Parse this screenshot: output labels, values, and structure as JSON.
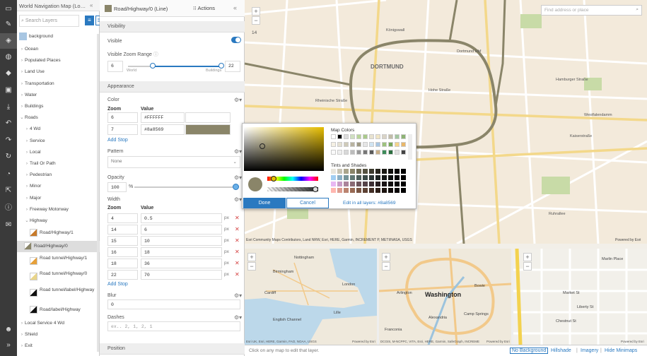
{
  "toolbar": {
    "icons": [
      "folder-icon",
      "pencil-icon",
      "layers-icon",
      "palette-icon",
      "shapes-icon",
      "save-icon",
      "download-icon",
      "undo-icon",
      "redo-icon",
      "rotate-icon",
      "gauge-icon",
      "share-icon",
      "info-icon",
      "mail-icon",
      "user-icon",
      "expand-icon"
    ]
  },
  "layers_panel": {
    "title": "World Navigation Map (Lo…",
    "search_placeholder": "Search Layers",
    "items": [
      {
        "label": "background",
        "swatch": "#a8c6e2"
      },
      {
        "label": "Ocean"
      },
      {
        "label": "Populated Places"
      },
      {
        "label": "Land Use"
      },
      {
        "label": "Transportation"
      },
      {
        "label": "Water"
      },
      {
        "label": "Buildings"
      },
      {
        "label": "Roads"
      },
      {
        "label": "4 Wd"
      },
      {
        "label": "Service"
      },
      {
        "label": "Local"
      },
      {
        "label": "Trail Or Path"
      },
      {
        "label": "Pedestrian"
      },
      {
        "label": "Minor"
      },
      {
        "label": "Major"
      },
      {
        "label": "Freeway Motorway"
      },
      {
        "label": "Highway"
      },
      {
        "label": "Road/Highway/1"
      },
      {
        "label": "Road/Highway/0"
      },
      {
        "label": "Road tunnel/Highway/1"
      },
      {
        "label": "Road tunnel/Highway/0"
      },
      {
        "label": "Road tunnel/label/Highway"
      },
      {
        "label": "Road/label/Highway"
      },
      {
        "label": "Local Service 4 Wd"
      },
      {
        "label": "Shield"
      },
      {
        "label": "Exit"
      }
    ]
  },
  "props": {
    "title": "Road/Highway/0 (Line)",
    "actions_label": "Actions",
    "visibility": {
      "section": "Visibility",
      "visible_label": "Visible",
      "zoom_range_label": "Visible Zoom Range",
      "zoom_min": "6",
      "zoom_max": "22",
      "scale_left": "World",
      "scale_right": "Buildings"
    },
    "appearance": {
      "section": "Appearance",
      "color_label": "Color",
      "zoom_col": "Zoom",
      "value_col": "Value",
      "color_rows": [
        {
          "zoom": "6",
          "value": "#FFFFFF",
          "swatch": "#ffffff"
        },
        {
          "zoom": "7",
          "value": "#8a8569",
          "swatch": "#8a8569"
        }
      ],
      "add_stop": "Add Stop",
      "pattern_label": "Pattern",
      "pattern_value": "None",
      "opacity_label": "Opacity",
      "opacity_value": "100",
      "opacity_unit": "%",
      "opacity_level": 1.0,
      "width_label": "Width",
      "width_rows": [
        {
          "zoom": "4",
          "value": "0.5"
        },
        {
          "zoom": "14",
          "value": "6"
        },
        {
          "zoom": "15",
          "value": "10"
        },
        {
          "zoom": "16",
          "value": "18"
        },
        {
          "zoom": "18",
          "value": "36"
        },
        {
          "zoom": "22",
          "value": "70"
        }
      ],
      "width_unit": "px",
      "add_stop2": "Add Stop",
      "blur_label": "Blur",
      "blur_value": "0",
      "dashes_label": "Dashes",
      "dashes_placeholder": "ex.. 2, 1, 2, 1"
    },
    "position_section": "Position"
  },
  "picker": {
    "map_colors_label": "Map Colors",
    "tints_label": "Tints and Shades",
    "done_label": "Done",
    "cancel_label": "Cancel",
    "edit_all_label": "Edit in all layers: #8a8569",
    "current_color": "#8a8569"
  },
  "map": {
    "search_placeholder": "Find address or place",
    "zoom_level": "14",
    "labels": [
      "Dortmund Hbf",
      "DORTMUND",
      "Rheinische Straße",
      "Königswall",
      "Hamburger Straße",
      "Ruhrallee",
      "Kaiserstraße",
      "Westfalendamm",
      "Hohe Straße"
    ],
    "attribution": "Esri Community Maps Contributors, Land NRW, Esri, HERE, Garmin, INCREMENT P, METI/NASA, USGS",
    "powered": "Powered by Esri"
  },
  "minimaps": [
    {
      "labels": [
        "Nottingham",
        "Birmingham",
        "Cardiff",
        "London",
        "Lille",
        "English Channel"
      ],
      "attribution": "Esri UK, Esri, HERE, Garmin, FAO, NOAA, USGS",
      "powered": "Powered by Esri"
    },
    {
      "labels": [
        "Washington",
        "Alexandria",
        "Arlington",
        "Camp Springs",
        "Franconia",
        "Bowie"
      ],
      "attribution": "DCGIS, M-NCPPC, VITA, Esri, HERE, Garmin, SafeGraph, INCREMENT P, METI/NASA, EPA, USDA",
      "powered": "Powered by Esri"
    },
    {
      "labels": [
        "Marlin Place",
        "Market St",
        "Liberty St",
        "Chestnut St"
      ],
      "attribution": "",
      "powered": "Powered by Esri"
    }
  ],
  "footer": {
    "hint": "Click on any map to edit that layer.",
    "no_background": "No Background",
    "hillshade": "Hillshade",
    "imagery": "Imagery",
    "hide_minimaps": "Hide Minimaps",
    "sep": "|"
  }
}
